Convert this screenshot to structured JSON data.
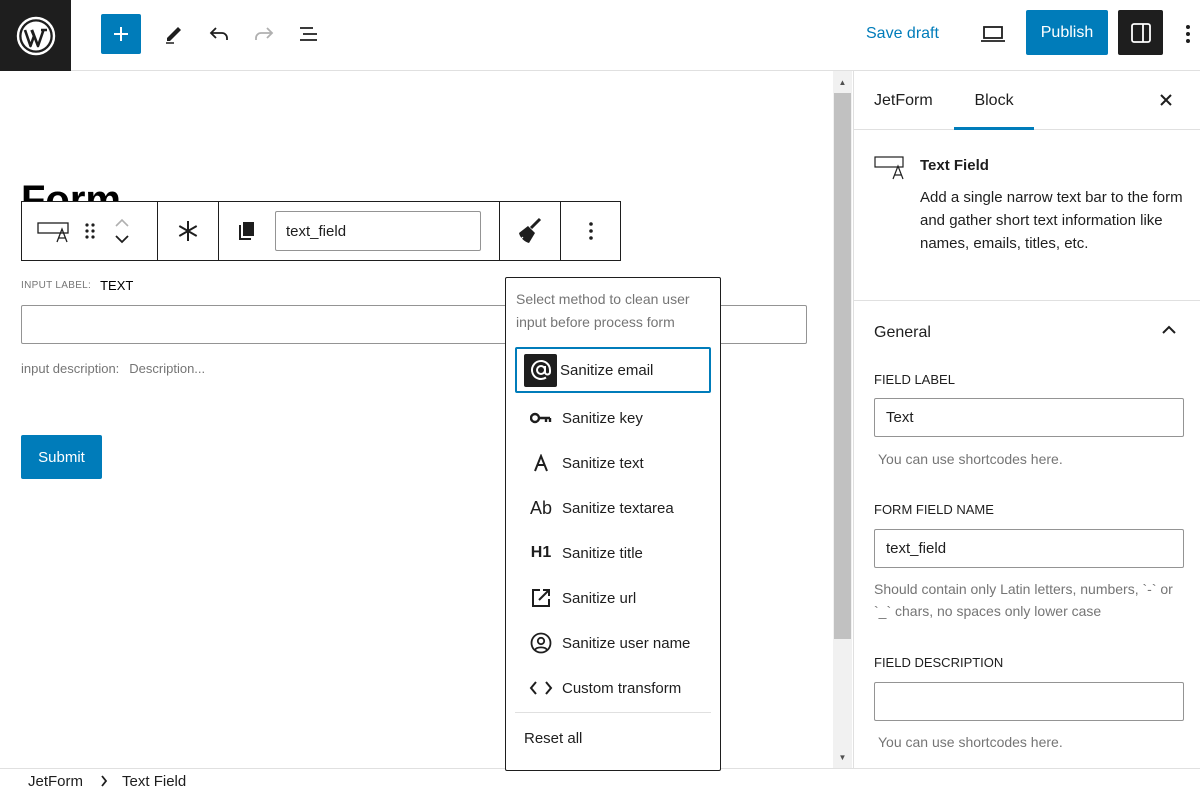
{
  "topbar": {
    "save_draft": "Save draft",
    "publish": "Publish"
  },
  "canvas": {
    "heading": "Form",
    "field_name_value": "text_field",
    "input_label_key": "INPUT LABEL:",
    "input_label_value": "TEXT",
    "description_key": "input description:",
    "description_placeholder": "Description...",
    "submit_label": "Submit"
  },
  "dropdown": {
    "hint": "Select method to clean user input before process form",
    "items": [
      {
        "label": "Sanitize email",
        "icon": "at-sign-icon"
      },
      {
        "label": "Sanitize key",
        "icon": "key-icon"
      },
      {
        "label": "Sanitize text",
        "icon": "text-a-icon"
      },
      {
        "label": "Sanitize textarea",
        "icon": "textarea-ab-icon"
      },
      {
        "label": "Sanitize title",
        "icon": "heading-h1-icon"
      },
      {
        "label": "Sanitize url",
        "icon": "external-link-icon"
      },
      {
        "label": "Sanitize user name",
        "icon": "user-circle-icon"
      },
      {
        "label": "Custom transform",
        "icon": "code-icon"
      }
    ],
    "reset": "Reset all"
  },
  "sidebar": {
    "tabs": [
      "JetForm",
      "Block"
    ],
    "active_tab": "Block",
    "block_title": "Text Field",
    "block_desc": "Add a single narrow text bar to the form and gather short text information like names, emails, titles, etc.",
    "general": "General",
    "field_label_title": "FIELD LABEL",
    "field_label_value": "Text",
    "field_label_help": "You can use shortcodes here.",
    "form_field_name_title": "FORM FIELD NAME",
    "form_field_name_value": "text_field",
    "form_field_name_help": "Should contain only Latin letters, numbers, `-` or `_` chars, no spaces only lower case",
    "field_desc_title": "FIELD DESCRIPTION",
    "field_desc_value": "",
    "field_desc_help": "You can use shortcodes here."
  },
  "footer": {
    "crumbs": [
      "JetForm",
      "Text Field"
    ]
  },
  "colors": {
    "accent": "#007cba",
    "dark": "#1e1e1e"
  }
}
